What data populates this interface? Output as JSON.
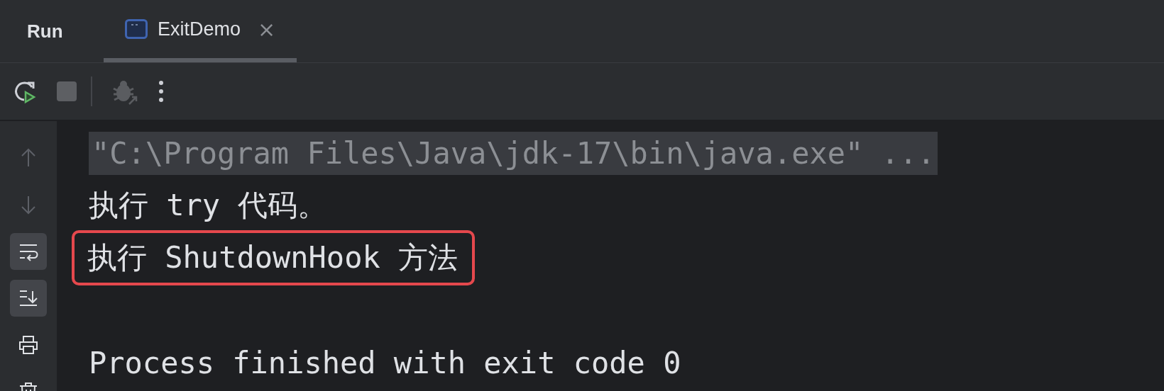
{
  "panel": {
    "title": "Run"
  },
  "tabs": [
    {
      "label": "ExitDemo",
      "selected": true,
      "close": "×"
    }
  ],
  "toolbar": [
    {
      "kind": "rerun",
      "disabled": false
    },
    {
      "kind": "stop",
      "disabled": true
    },
    {
      "kind": "debug",
      "disabled": true
    },
    {
      "kind": "more",
      "disabled": false
    }
  ],
  "gutter": [
    {
      "kind": "up",
      "on": false
    },
    {
      "kind": "down",
      "on": false
    },
    {
      "kind": "wrap",
      "on": true
    },
    {
      "kind": "scroll",
      "on": true
    },
    {
      "kind": "print",
      "on": false
    },
    {
      "kind": "trash",
      "on": false
    }
  ],
  "console": [
    {
      "kind": "command",
      "text": "\"C:\\Program Files\\Java\\jdk-17\\bin\\java.exe\" ...",
      "highlighted": false
    },
    {
      "kind": "output",
      "text": "执行 try 代码。",
      "highlighted": false
    },
    {
      "kind": "output",
      "text": "执行 ShutdownHook 方法",
      "highlighted": true
    },
    {
      "kind": "blank"
    },
    {
      "kind": "output",
      "text": "Process finished with exit code 0",
      "highlighted": false
    }
  ]
}
